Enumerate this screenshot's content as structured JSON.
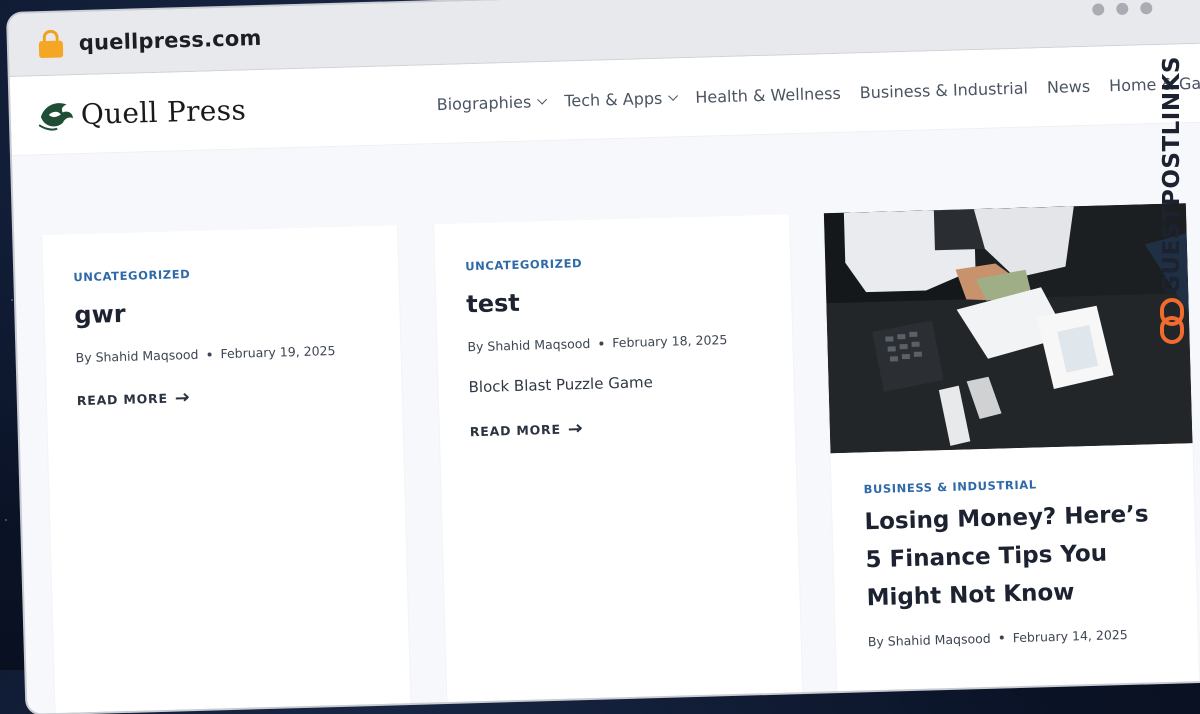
{
  "browser": {
    "url": "quellpress.com"
  },
  "site": {
    "logo_text": "Quell Press",
    "nav": [
      {
        "label": "Biographies",
        "has_dropdown": true
      },
      {
        "label": "Tech & Apps",
        "has_dropdown": true
      },
      {
        "label": "Health & Wellness",
        "has_dropdown": false
      },
      {
        "label": "Business & Industrial",
        "has_dropdown": false
      },
      {
        "label": "News",
        "has_dropdown": false
      },
      {
        "label": "Home & Garden",
        "has_dropdown": false
      }
    ]
  },
  "posts": [
    {
      "category": "UNCATEGORIZED",
      "title": "gwr",
      "author": "By Shahid Maqsood",
      "date": "February 19, 2025",
      "excerpt": "",
      "read_more": "READ MORE"
    },
    {
      "category": "UNCATEGORIZED",
      "title": "test",
      "author": "By Shahid Maqsood",
      "date": "February 18, 2025",
      "excerpt": "Block Blast Puzzle Game",
      "read_more": "READ MORE"
    },
    {
      "category": "BUSINESS & INDUSTRIAL",
      "title": "Losing Money? Here’s 5 Finance Tips You Might Not Know",
      "author": "By Shahid Maqsood",
      "date": "February 14, 2025"
    }
  ],
  "watermark": {
    "text": "GUESTPOSTLINKS"
  },
  "colors": {
    "accent": "#2f6aa8",
    "page_bg": "#f6f8fb",
    "watermark_orange": "#f26b2e"
  }
}
